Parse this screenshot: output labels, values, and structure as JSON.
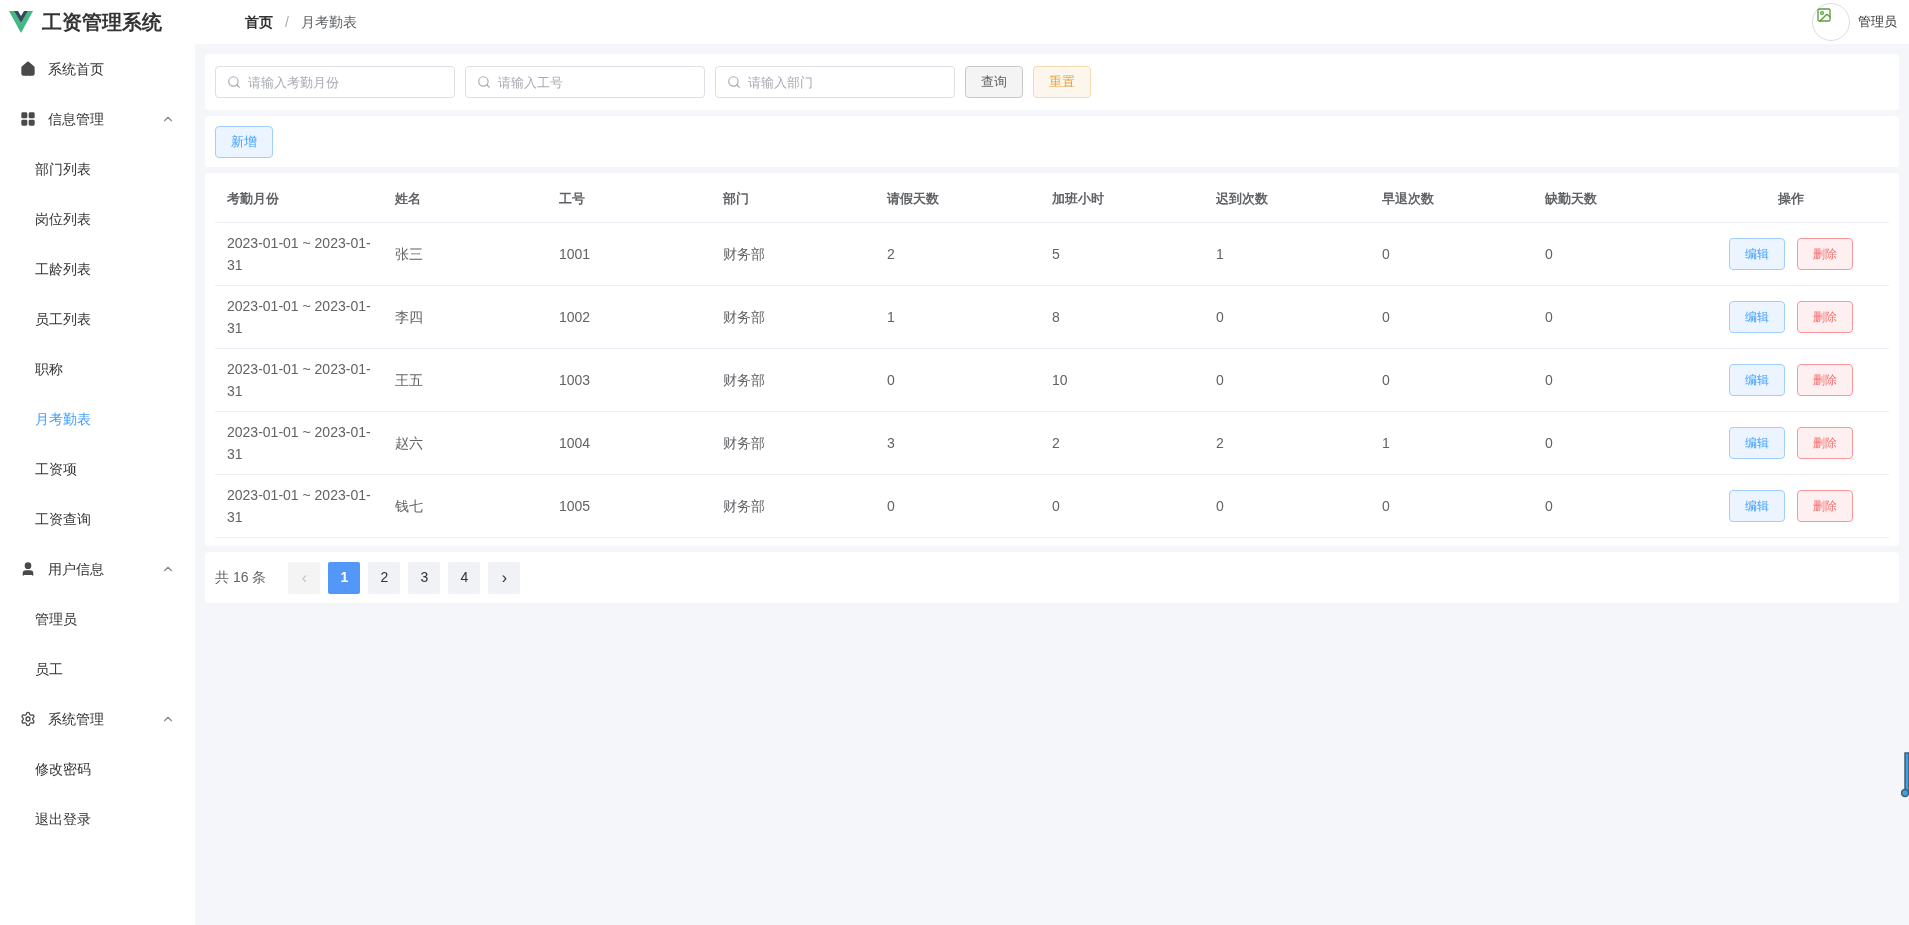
{
  "app": {
    "title": "工资管理系统"
  },
  "breadcrumb": [
    "首页",
    "月考勤表"
  ],
  "breadcrumb_separator": "/",
  "user": {
    "name": "管理员"
  },
  "sidebar": [
    {
      "label": "系统首页",
      "kind": "item",
      "selected": false
    },
    {
      "label": "信息管理",
      "kind": "group",
      "expanded": true,
      "children": [
        {
          "label": "部门列表",
          "selected": false
        },
        {
          "label": "岗位列表",
          "selected": false
        },
        {
          "label": "工龄列表",
          "selected": false
        },
        {
          "label": "员工列表",
          "selected": false
        },
        {
          "label": "职称",
          "selected": false
        },
        {
          "label": "月考勤表",
          "selected": true
        },
        {
          "label": "工资项",
          "selected": false
        },
        {
          "label": "工资查询",
          "selected": false
        }
      ]
    },
    {
      "label": "用户信息",
      "kind": "group",
      "expanded": true,
      "children": [
        {
          "label": "管理员",
          "selected": false
        },
        {
          "label": "员工",
          "selected": false
        }
      ]
    },
    {
      "label": "系统管理",
      "kind": "group",
      "expanded": true,
      "children": [
        {
          "label": "修改密码",
          "selected": false
        },
        {
          "label": "退出登录",
          "selected": false
        }
      ]
    }
  ],
  "filters": [
    {
      "placeholder": "请输入考勤月份"
    },
    {
      "placeholder": "请输入工号"
    },
    {
      "placeholder": "请输入部门"
    }
  ],
  "filter_buttons": [
    {
      "label": "查询",
      "kind": "default"
    },
    {
      "label": "重置",
      "kind": "warning"
    }
  ],
  "add_button": "新增",
  "table": {
    "columns": [
      "考勤月份",
      "姓名",
      "工号",
      "部门",
      "请假天数",
      "加班小时",
      "迟到次数",
      "早退次数",
      "缺勤天数",
      "操作"
    ],
    "rows": [
      {
        "cells": [
          "2023-01-01 ~ 2023-01-31",
          "张三",
          "1001",
          "财务部",
          "2",
          "5",
          "1",
          "0",
          "0"
        ],
        "actions": [
          "编辑",
          "删除"
        ]
      },
      {
        "cells": [
          "2023-01-01 ~ 2023-01-31",
          "李四",
          "1002",
          "财务部",
          "1",
          "8",
          "0",
          "0",
          "0"
        ],
        "actions": [
          "编辑",
          "删除"
        ]
      },
      {
        "cells": [
          "2023-01-01 ~ 2023-01-31",
          "王五",
          "1003",
          "财务部",
          "0",
          "10",
          "0",
          "0",
          "0"
        ],
        "actions": [
          "编辑",
          "删除"
        ]
      },
      {
        "cells": [
          "2023-01-01 ~ 2023-01-31",
          "赵六",
          "1004",
          "财务部",
          "3",
          "2",
          "2",
          "1",
          "0"
        ],
        "actions": [
          "编辑",
          "删除"
        ]
      },
      {
        "cells": [
          "2023-01-01 ~ 2023-01-31",
          "钱七",
          "1005",
          "财务部",
          "0",
          "0",
          "0",
          "0",
          "0"
        ],
        "actions": [
          "编辑",
          "删除"
        ]
      }
    ]
  },
  "pagination": {
    "total": "共 16 条",
    "prev": "‹",
    "next": "›",
    "pages": [
      {
        "label": "1",
        "selected": true
      },
      {
        "label": "2",
        "selected": false
      },
      {
        "label": "3",
        "selected": false
      },
      {
        "label": "4",
        "selected": false
      }
    ]
  }
}
